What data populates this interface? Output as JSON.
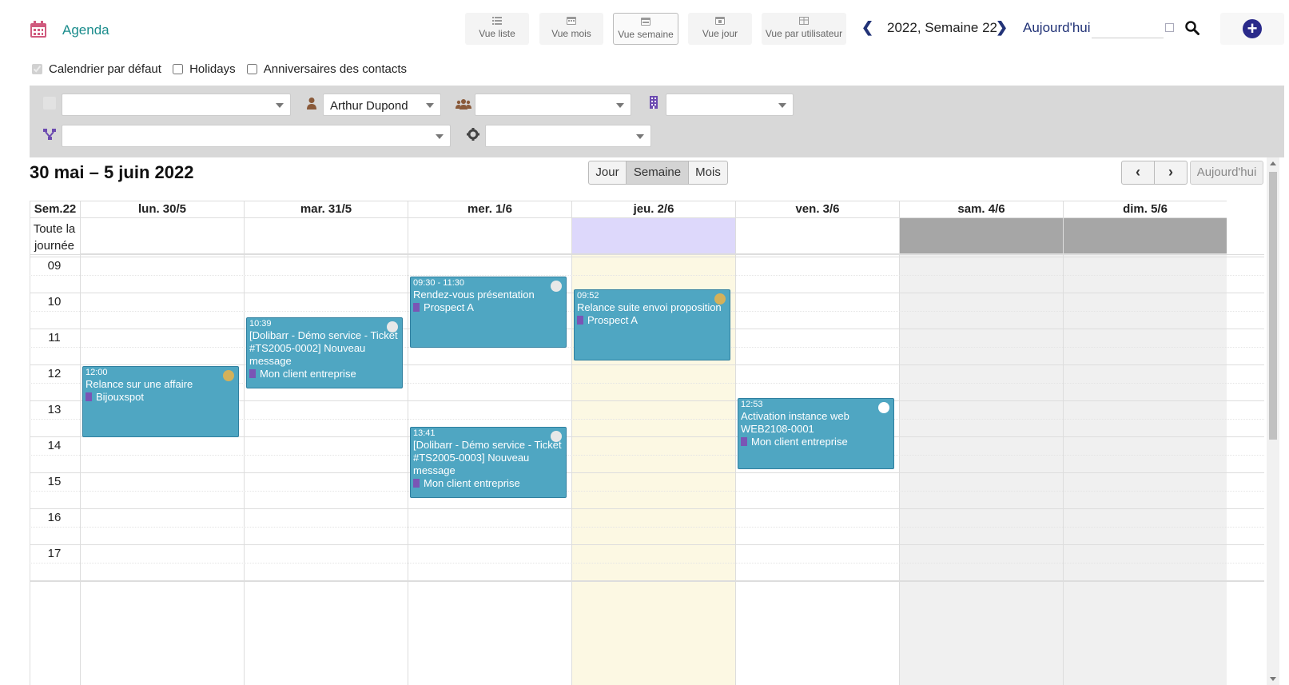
{
  "app": {
    "title": "Agenda"
  },
  "views": [
    {
      "label": "Vue liste",
      "icon": "list-icon"
    },
    {
      "label": "Vue mois",
      "icon": "calendar-month-icon"
    },
    {
      "label": "Vue semaine",
      "icon": "calendar-week-icon"
    },
    {
      "label": "Vue jour",
      "icon": "calendar-day-icon"
    },
    {
      "label": "Vue par utilisateur",
      "icon": "table-icon"
    }
  ],
  "nav": {
    "week_label": "2022, Semaine 22",
    "today_label": "Aujourd'hui"
  },
  "calendars": [
    {
      "label": "Calendrier par défaut",
      "checked": true,
      "disabled": true
    },
    {
      "label": "Holidays",
      "checked": false
    },
    {
      "label": "Anniversaires des contacts",
      "checked": false
    }
  ],
  "filters": {
    "type": "",
    "user": "Arthur Dupond",
    "group": "",
    "company": "",
    "project": "",
    "status": ""
  },
  "calendar": {
    "range_title": "30 mai – 5 juin 2022",
    "view_buttons": [
      "Jour",
      "Semaine",
      "Mois"
    ],
    "active_view": "Semaine",
    "prev_glyph": "‹",
    "next_glyph": "›",
    "today_button": "Aujourd'hui",
    "week_label": "Sem.22",
    "allday_label": "Toute la journée",
    "days": [
      "lun. 30/5",
      "mar. 31/5",
      "mer. 1/6",
      "jeu. 2/6",
      "ven. 3/6",
      "sam. 4/6",
      "dim. 5/6"
    ],
    "hours": [
      "09",
      "10",
      "11",
      "12",
      "13",
      "14",
      "15",
      "16",
      "17"
    ],
    "colors": {
      "event": "#4fa6c2",
      "today_allday": "#ddd8fb",
      "today_col": "#fcf8e3",
      "weekend": "#f0f0f0",
      "weekend_allday": "#a6a6a6"
    },
    "events": [
      {
        "day": 0,
        "time": "12:00",
        "title": "Relance sur une affaire",
        "org": "Bijouxspot",
        "dot": "#d4b15a"
      },
      {
        "day": 1,
        "time": "10:39",
        "title": "[Dolibarr - Démo service - Ticket #TS2005-0002] Nouveau message",
        "org": "Mon client entreprise",
        "dot": "#e8e8e8"
      },
      {
        "day": 2,
        "time": "09:30 - 11:30",
        "title": "Rendez-vous présentation",
        "org": "Prospect A",
        "dot": "#e8e8e8"
      },
      {
        "day": 2,
        "time": "13:41",
        "title": "[Dolibarr - Démo service - Ticket #TS2005-0003] Nouveau message",
        "org": "Mon client entreprise",
        "dot": "#e8e8e8"
      },
      {
        "day": 3,
        "time": "09:52",
        "title": "Relance suite envoi proposition",
        "org": "Prospect A",
        "dot": "#d4b15a"
      },
      {
        "day": 4,
        "time": "12:53",
        "title": "Activation instance web WEB2108-0001",
        "org": "Mon client entreprise",
        "dot": "#ffffff"
      }
    ]
  }
}
